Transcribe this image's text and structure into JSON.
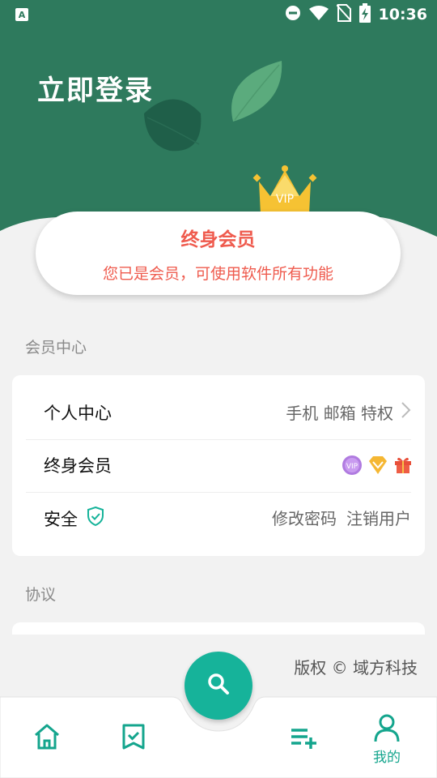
{
  "status_bar": {
    "time": "10:36"
  },
  "header": {
    "login_label": "立即登录"
  },
  "member": {
    "title": "终身会员",
    "subtitle": "您已是会员，可使用软件所有功能",
    "crown_text": "VIP"
  },
  "sections": {
    "member_center": "会员中心",
    "agreements": "协议"
  },
  "rows": {
    "personal": {
      "label": "个人中心",
      "detail": "手机 邮箱 特权"
    },
    "lifetime": {
      "label": "终身会员"
    },
    "security": {
      "label": "安全",
      "action1": "修改密码",
      "action2": "注销用户"
    }
  },
  "footer": {
    "copyright": "版权 © 域方科技"
  },
  "bottom_nav": {
    "mine_label": "我的"
  },
  "colors": {
    "header_green": "#2e7a5d",
    "accent_teal": "#16b39a",
    "member_red": "#ef5b4e"
  },
  "icons": [
    "home-icon",
    "bookmark-check-icon",
    "search-icon",
    "playlist-add-icon",
    "person-icon",
    "shield-check-icon",
    "chevron-right-icon",
    "vip-badge-icon",
    "diamond-icon",
    "gift-icon"
  ]
}
